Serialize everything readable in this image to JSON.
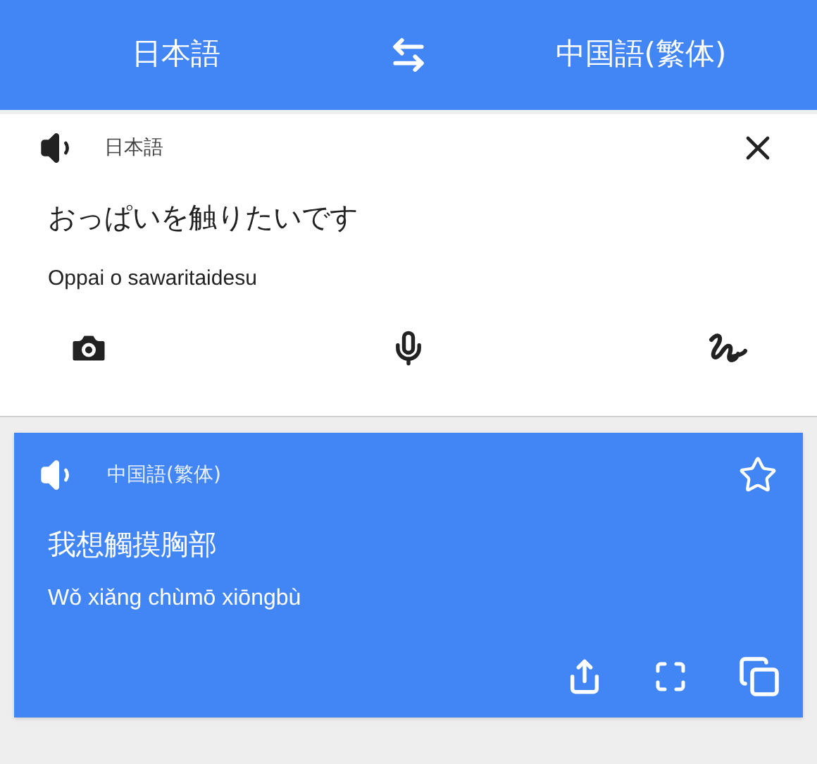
{
  "header": {
    "source_language": "日本語",
    "target_language": "中国語(繁体)"
  },
  "input": {
    "language": "日本語",
    "text": "おっぱいを触りたいです",
    "romanization": "Oppai o sawaritaidesu"
  },
  "result": {
    "language": "中国語(繁体)",
    "text": "我想觸摸胸部",
    "romanization": "Wǒ xiǎng chùmō xiōngbù",
    "starred": false
  }
}
